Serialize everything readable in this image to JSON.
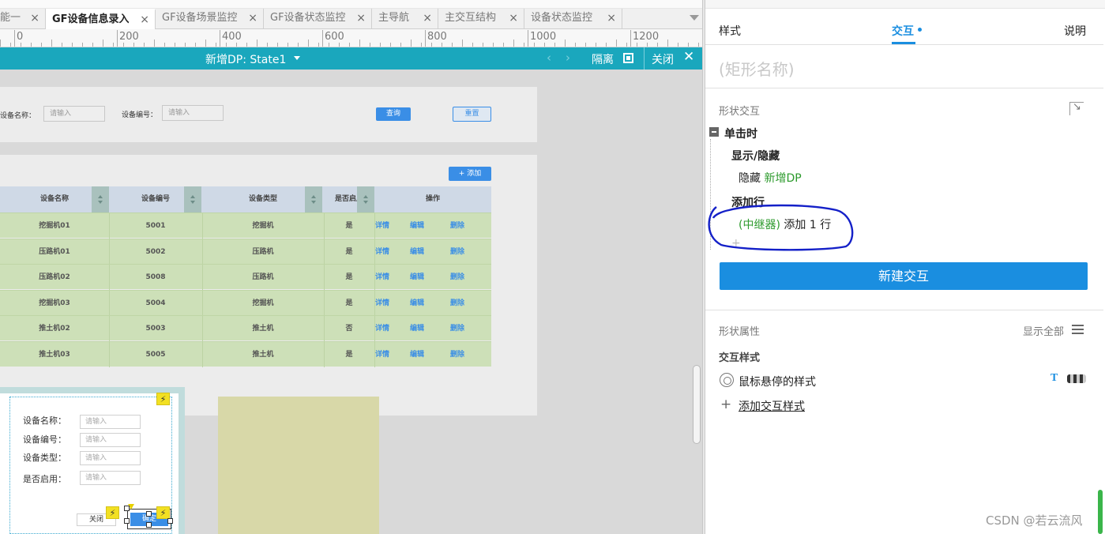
{
  "tabs": [
    {
      "label": "能一",
      "active": false
    },
    {
      "label": "GF设备信息录入",
      "active": true
    },
    {
      "label": "GF设备场景监控",
      "active": false
    },
    {
      "label": "GF设备状态监控",
      "active": false
    },
    {
      "label": "主导航",
      "active": false
    },
    {
      "label": "主交互结构",
      "active": false
    },
    {
      "label": "设备状态监控",
      "active": false
    }
  ],
  "ruler": {
    "labels": [
      "0",
      "200",
      "400",
      "600",
      "800",
      "1000",
      "1200"
    ]
  },
  "state_bar": {
    "title": "新增DP: State1",
    "prev_arrow": "‹",
    "next_arrow": "›",
    "isolate": "隔离",
    "close": "关闭",
    "close_x": "✕"
  },
  "query": {
    "device_name_label": "设备名称：",
    "device_name_placeholder": "请输入",
    "device_no_label": "设备编号：",
    "device_no_placeholder": "请输入",
    "query_button": "查询",
    "reset_button": "重置"
  },
  "table": {
    "add_button": "+ 添加",
    "headers": [
      "设备名称",
      "设备编号",
      "设备类型",
      "是否启用",
      "操作"
    ],
    "rows": [
      {
        "name": "挖掘机01",
        "no": "5001",
        "type": "挖掘机",
        "enabled": "是"
      },
      {
        "name": "压路机01",
        "no": "5002",
        "type": "压路机",
        "enabled": "是"
      },
      {
        "name": "压路机02",
        "no": "5008",
        "type": "压路机",
        "enabled": "是"
      },
      {
        "name": "挖掘机03",
        "no": "5004",
        "type": "挖掘机",
        "enabled": "是"
      },
      {
        "name": "推土机02",
        "no": "5003",
        "type": "推土机",
        "enabled": "否"
      },
      {
        "name": "推土机03",
        "no": "5005",
        "type": "推土机",
        "enabled": "是"
      }
    ],
    "actions": [
      "详情",
      "编辑",
      "删除"
    ]
  },
  "dialog": {
    "fields": [
      {
        "label": "设备名称：",
        "placeholder": "请输入"
      },
      {
        "label": "设备编号：",
        "placeholder": "请输入"
      },
      {
        "label": "设备类型：",
        "placeholder": "请输入"
      },
      {
        "label": "是否启用：",
        "placeholder": "请输入"
      }
    ],
    "close_button": "关闭",
    "confirm_button": "确定",
    "bolt": "⚡"
  },
  "right_panel": {
    "tabs": {
      "style": "样式",
      "interaction": "交互",
      "notes": "说明"
    },
    "shape_name": "(矩形名称)",
    "section_interaction": "形状交互",
    "event_title": "单击时",
    "case1_title": "显示/隐藏",
    "case1_action": "隐藏",
    "case1_target": "新增DP",
    "case2_title": "添加行",
    "case2_target": "(中继器)",
    "case2_action": "添加 1 行",
    "add_plus": "+",
    "new_interaction_button": "新建交互",
    "section_props": "形状属性",
    "show_all": "显示全部",
    "interaction_style_title": "交互样式",
    "hover_style": "鼠标悬停的样式",
    "t_icon": "T",
    "add_style_plus": "+",
    "add_interaction_style": "添加交互样式"
  },
  "watermark": "CSDN @若云流风",
  "colors": {
    "accent": "#1a8ee0",
    "state_bar": "#1aa7bd",
    "row_green": "#cde0b8",
    "target_green": "#2c9a2c",
    "annotation_circle": "#1420c8"
  }
}
